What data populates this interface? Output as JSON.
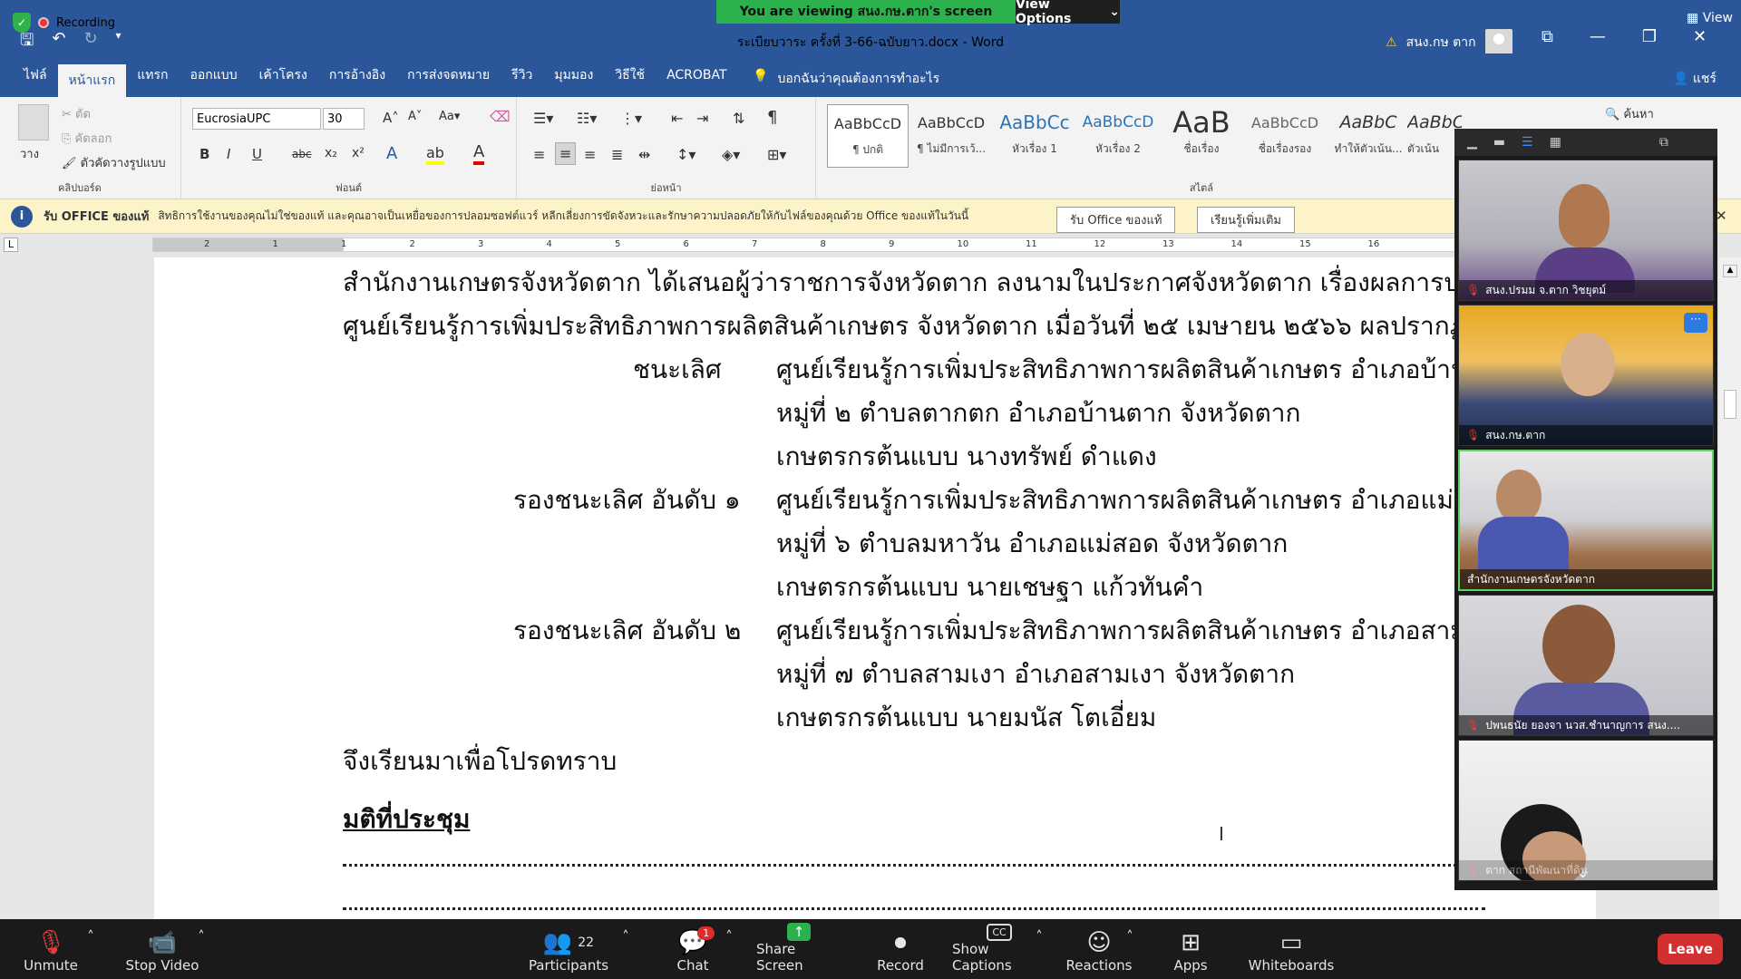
{
  "zoom": {
    "recording_label": "Recording",
    "viewing_banner": "You are viewing สนง.กษ.ตาก's screen",
    "view_options": "View Options",
    "view_label": "View"
  },
  "word": {
    "doc_title": "ระเบียบวาระ ครั้งที่ 3-66-ฉบับยาว.docx  -  Word",
    "user_name": "สนง.กษ ตาก",
    "tabs": [
      "ไฟล์",
      "หน้าแรก",
      "แทรก",
      "ออกแบบ",
      "เค้าโครง",
      "การอ้างอิง",
      "การส่งจดหมาย",
      "รีวิว",
      "มุมมอง",
      "วิธีใช้",
      "ACROBAT"
    ],
    "tell_me": "บอกฉันว่าคุณต้องการทำอะไร",
    "share": "แชร์",
    "clipboard": {
      "paste": "วาง",
      "cut": "ตัด",
      "copy": "คัดลอก",
      "format_painter": "ตัวคัดวางรูปแบบ",
      "group": "คลิปบอร์ด"
    },
    "font": {
      "name": "EucrosiaUPC",
      "size": "30",
      "group": "ฟอนต์"
    },
    "paragraph_group": "ย่อหน้า",
    "styles_group": "สไตล์",
    "styles": [
      {
        "preview": "AaBbCcD",
        "name": "¶ ปกติ"
      },
      {
        "preview": "AaBbCcD",
        "name": "¶ ไม่มีการเว้..."
      },
      {
        "preview": "AaBbCc",
        "name": "หัวเรื่อง 1"
      },
      {
        "preview": "AaBbCcD",
        "name": "หัวเรื่อง 2"
      },
      {
        "preview": "AaB",
        "name": "ชื่อเรื่อง"
      },
      {
        "preview": "AaBbCcD",
        "name": "ชื่อเรื่องรอง"
      },
      {
        "preview": "AaBbC",
        "name": "ทำให้ตัวเน้น..."
      },
      {
        "preview": "AaBbC",
        "name": "ตัวเน้น"
      }
    ],
    "find": "ค้นหา",
    "info_bar": {
      "title": "รับ OFFICE ของแท้",
      "message": "สิทธิการใช้งานของคุณไม่ใช่ของแท้ และคุณอาจเป็นเหยื่อของการปลอมซอฟต์แวร์ หลีกเลี่ยงการขัดจังหวะและรักษาความปลอดภัยให้กับไฟล์ของคุณด้วย Office ของแท้ในวันนี้",
      "btn_get": "รับ Office ของแท้",
      "btn_learn": "เรียนรู้เพิ่มเติม"
    },
    "ruler_numbers": [
      "2",
      "1",
      "1",
      "2",
      "3",
      "4",
      "5",
      "6",
      "7",
      "8",
      "9",
      "10",
      "11",
      "12",
      "13",
      "14",
      "15",
      "16"
    ],
    "document": {
      "line1": "สำนักงานเกษตรจังหวัดตาก ได้เสนอผู้ว่าราชการจังหวัดตาก ลงนามในประกาศจังหวัดตาก เรื่องผลการประก",
      "line2": "ศูนย์เรียนรู้การเพิ่มประสิทธิภาพการผลิตสินค้าเกษตร จังหวัดตาก เมื่อวันที่ ๒๕ เมษายน ๒๕๖๖ ผลปรากฏ ดังนี้",
      "entries": [
        {
          "rank": "ชนะเลิศ",
          "l1": "ศูนย์เรียนรู้การเพิ่มประสิทธิภาพการผลิตสินค้าเกษตร อำเภอบ้านตาก",
          "l2": "หมู่ที่ ๒ ตำบลตากตก อำเภอบ้านตาก จังหวัดตาก",
          "l3": "เกษตรกรต้นแบบ นางทรัพย์ ดำแดง"
        },
        {
          "rank": "รองชนะเลิศ อันดับ ๑",
          "l1": "ศูนย์เรียนรู้การเพิ่มประสิทธิภาพการผลิตสินค้าเกษตร อำเภอแม่สอด",
          "l2": "หมู่ที่ ๖ ตำบลมหาวัน อำเภอแม่สอด จังหวัดตาก",
          "l3": "เกษตรกรต้นแบบ นายเชษฐา   แก้วทันคำ"
        },
        {
          "rank": "รองชนะเลิศ อันดับ ๒",
          "l1": "ศูนย์เรียนรู้การเพิ่มประสิทธิภาพการผลิตสินค้าเกษตร อำเภอสามเงา",
          "l2": "หมู่ที่ ๗ ตำบลสามเงา อำเภอสามเงา จังหวัดตาก",
          "l3": "เกษตรกรต้นแบบ นายมนัส  โตเอี่ยม"
        }
      ],
      "closing": "จึงเรียนมาเพื่อโปรดทราบ",
      "resolution": "มติที่ประชุม"
    }
  },
  "participants_gallery": [
    {
      "name": "สนง.ปรมม จ.ตาก วิชยุตม์",
      "muted": true
    },
    {
      "name": "สนง.กษ.ตาก",
      "muted": true
    },
    {
      "name": "สำนักงานเกษตรจังหวัดตาก",
      "muted": false
    },
    {
      "name": "ปพนธนัย ยองจา นวส.ชำนาญการ สนง....",
      "muted": true
    },
    {
      "name": "ตาก สถานีพัฒนาที่ดิน",
      "muted": true
    }
  ],
  "toolbar": {
    "unmute": "Unmute",
    "stop_video": "Stop Video",
    "participants": "Participants",
    "participants_count": "22",
    "chat": "Chat",
    "chat_badge": "1",
    "share_screen": "Share Screen",
    "record": "Record",
    "captions": "Show Captions",
    "reactions": "Reactions",
    "apps": "Apps",
    "whiteboards": "Whiteboards",
    "leave": "Leave"
  },
  "colors": {
    "word_blue": "#2b579a",
    "zoom_green": "#2bb24c",
    "leave_red": "#d23030",
    "info_yellow": "#fcf4c8"
  }
}
